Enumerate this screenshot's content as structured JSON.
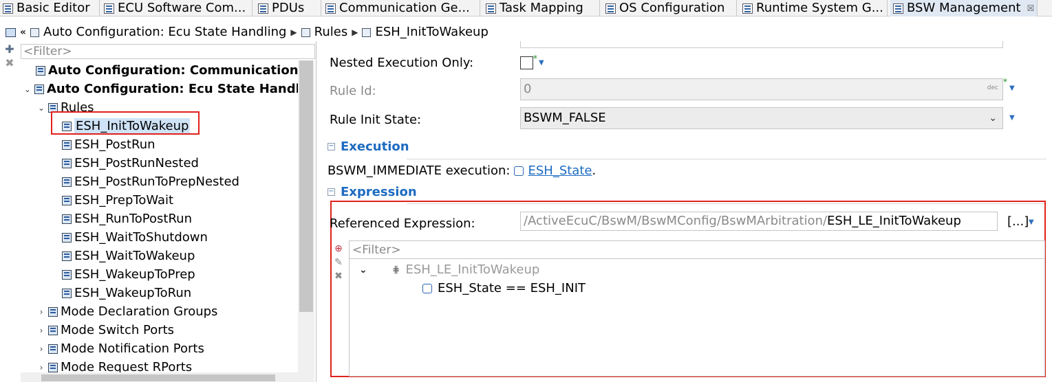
{
  "tabs": [
    {
      "label": "Basic Editor"
    },
    {
      "label": "ECU Software Com..."
    },
    {
      "label": "PDUs"
    },
    {
      "label": "Communication Ge..."
    },
    {
      "label": "Task Mapping"
    },
    {
      "label": "OS Configuration"
    },
    {
      "label": "Runtime System G..."
    },
    {
      "label": "BSW Management",
      "close": "☒"
    }
  ],
  "breadcrumb": [
    "Auto Configuration: Ecu State Handling",
    "Rules",
    "ESH_InitToWakeup"
  ],
  "left": {
    "filter_placeholder": "<Filter>",
    "tree": [
      {
        "label": "Auto Configuration: Communication Co"
      },
      {
        "label": "Auto Configuration: Ecu State Handling"
      },
      {
        "label": "Rules"
      },
      {
        "label": "ESH_InitToWakeup"
      },
      {
        "label": "ESH_PostRun"
      },
      {
        "label": "ESH_PostRunNested"
      },
      {
        "label": "ESH_PostRunToPrepNested"
      },
      {
        "label": "ESH_PrepToWait"
      },
      {
        "label": "ESH_RunToPostRun"
      },
      {
        "label": "ESH_WaitToShutdown"
      },
      {
        "label": "ESH_WaitToWakeup"
      },
      {
        "label": "ESH_WakeupToPrep"
      },
      {
        "label": "ESH_WakeupToRun"
      },
      {
        "label": "Mode Declaration Groups"
      },
      {
        "label": "Mode Switch Ports"
      },
      {
        "label": "Mode Notification Ports"
      },
      {
        "label": "Mode Request RPorts"
      }
    ]
  },
  "props": {
    "nested_label": "Nested Execution Only:",
    "ruleid_label": "Rule Id:",
    "ruleid_value": "0",
    "ruleid_unit": "dec",
    "init_label": "Rule Init State:",
    "init_value": "BSWM_FALSE",
    "required_marker": "*"
  },
  "execution": {
    "title": "Execution",
    "text": "BSWM_IMMEDIATE execution:",
    "link": "ESH_State",
    "tail": "."
  },
  "expression": {
    "title": "Expression",
    "ref_label": "Referenced Expression:",
    "ref_path": "/ActiveEcuC/BswM/BswMConfig/BswMArbitration/",
    "ref_name": "ESH_LE_InitToWakeup",
    "browse": "[...]",
    "filter_placeholder": "<Filter>",
    "tree_root": "ESH_LE_InitToWakeup",
    "tree_child": "ESH_State == ESH_INIT"
  }
}
